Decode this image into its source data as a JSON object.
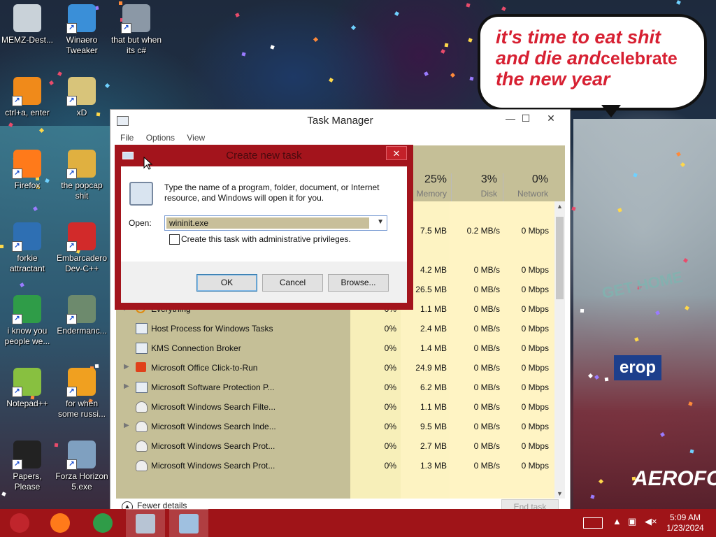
{
  "desktop": {
    "bubble": {
      "line1": "it's time to eat shit",
      "line2a": "and die and",
      "line2b": "celebrate",
      "line3": "the new year"
    },
    "wallpaper_text": {
      "get_home": "GET HOME",
      "erop": "erop",
      "aero": "AEROFO"
    },
    "icons": [
      {
        "label": "MEMZ-Dest...",
        "color": "#c9d2d9"
      },
      {
        "label": "Winaero Tweaker",
        "color": "#3a8fd8"
      },
      {
        "label": "that but when its c#",
        "color": "#8b98a6"
      },
      {
        "label": "ctrl+a, enter",
        "color": "#f08a1a"
      },
      {
        "label": "xD",
        "color": "#d8c47a"
      },
      {
        "label": "Firefox",
        "color": "#ff7a1a"
      },
      {
        "label": "the popcap shit",
        "color": "#e0b040"
      },
      {
        "label": "forkie attractant",
        "color": "#2e6fb3"
      },
      {
        "label": "Embarcadero Dev-C++",
        "color": "#d22a2a"
      },
      {
        "label": "i know you people we...",
        "color": "#2f9c48"
      },
      {
        "label": "Endermanc...",
        "color": "#6d8a6d"
      },
      {
        "label": "Notepad++",
        "color": "#88c040"
      },
      {
        "label": "for when some russi...",
        "color": "#f0a020"
      },
      {
        "label": "Papers, Please",
        "color": "#222222"
      },
      {
        "label": "Forza Horizon 5.exe",
        "color": "#7fa0c0"
      }
    ]
  },
  "task_manager": {
    "title": "Task Manager",
    "controls": {
      "minimize": "—",
      "maximize": "☐",
      "close": "✕"
    },
    "menu": [
      "File",
      "Options",
      "View"
    ],
    "columns": [
      {
        "pct": "25%",
        "label": "Memory"
      },
      {
        "pct": "3%",
        "label": "Disk"
      },
      {
        "pct": "0%",
        "label": "Network"
      }
    ],
    "rows": [
      {
        "name": "",
        "cpu": "",
        "mem": "",
        "disk": "",
        "net": "",
        "expand": false,
        "icon": ""
      },
      {
        "name": "",
        "cpu": "",
        "mem": "7.5 MB",
        "disk": "0.2 MB/s",
        "net": "0 Mbps",
        "expand": false,
        "icon": ""
      },
      {
        "name": "",
        "cpu": "",
        "mem": "",
        "disk": "",
        "net": "",
        "expand": false,
        "icon": ""
      },
      {
        "name": "",
        "cpu": "",
        "mem": "4.2 MB",
        "disk": "0 MB/s",
        "net": "0 Mbps",
        "expand": false,
        "icon": ""
      },
      {
        "name": "",
        "cpu": "",
        "mem": "26.5 MB",
        "disk": "0 MB/s",
        "net": "0 Mbps",
        "expand": false,
        "icon": ""
      },
      {
        "name": "Everything",
        "cpu": "0%",
        "mem": "1.1 MB",
        "disk": "0 MB/s",
        "net": "0 Mbps",
        "expand": true,
        "icon": "search"
      },
      {
        "name": "Host Process for Windows Tasks",
        "cpu": "0%",
        "mem": "2.4 MB",
        "disk": "0 MB/s",
        "net": "0 Mbps",
        "expand": false,
        "icon": "window"
      },
      {
        "name": "KMS Connection Broker",
        "cpu": "0%",
        "mem": "1.4 MB",
        "disk": "0 MB/s",
        "net": "0 Mbps",
        "expand": false,
        "icon": "window"
      },
      {
        "name": "Microsoft Office Click-to-Run",
        "cpu": "0%",
        "mem": "24.9 MB",
        "disk": "0 MB/s",
        "net": "0 Mbps",
        "expand": true,
        "icon": "office"
      },
      {
        "name": "Microsoft Software Protection P...",
        "cpu": "0%",
        "mem": "6.2 MB",
        "disk": "0 MB/s",
        "net": "0 Mbps",
        "expand": true,
        "icon": "window"
      },
      {
        "name": "Microsoft Windows Search Filte...",
        "cpu": "0%",
        "mem": "1.1 MB",
        "disk": "0 MB/s",
        "net": "0 Mbps",
        "expand": false,
        "icon": "user"
      },
      {
        "name": "Microsoft Windows Search Inde...",
        "cpu": "0%",
        "mem": "9.5 MB",
        "disk": "0 MB/s",
        "net": "0 Mbps",
        "expand": true,
        "icon": "user"
      },
      {
        "name": "Microsoft Windows Search Prot...",
        "cpu": "0%",
        "mem": "2.7 MB",
        "disk": "0 MB/s",
        "net": "0 Mbps",
        "expand": false,
        "icon": "user"
      },
      {
        "name": "Microsoft Windows Search Prot...",
        "cpu": "0%",
        "mem": "1.3 MB",
        "disk": "0 MB/s",
        "net": "0 Mbps",
        "expand": false,
        "icon": "user"
      }
    ],
    "fewer_details": "Fewer details",
    "end_task": "End task"
  },
  "run_dialog": {
    "title": "Create new task",
    "close": "✕",
    "description": "Type the name of a program, folder, document, or Internet resource, and Windows will open it for you.",
    "open_label": "Open:",
    "open_value": "wininit.exe",
    "admin_checkbox_label": "Create this task with administrative privileges.",
    "ok": "OK",
    "cancel": "Cancel",
    "browse": "Browse..."
  },
  "taskbar": {
    "items": [
      {
        "name": "start",
        "color": "#c0252c"
      },
      {
        "name": "firefox",
        "color": "#ff7a1a"
      },
      {
        "name": "chrome",
        "color": "#2f9c48"
      },
      {
        "name": "task-manager",
        "color": "#b7c4d4"
      },
      {
        "name": "run",
        "color": "#9fc0e0"
      }
    ],
    "time": "5:09 AM",
    "date": "1/23/2024"
  }
}
